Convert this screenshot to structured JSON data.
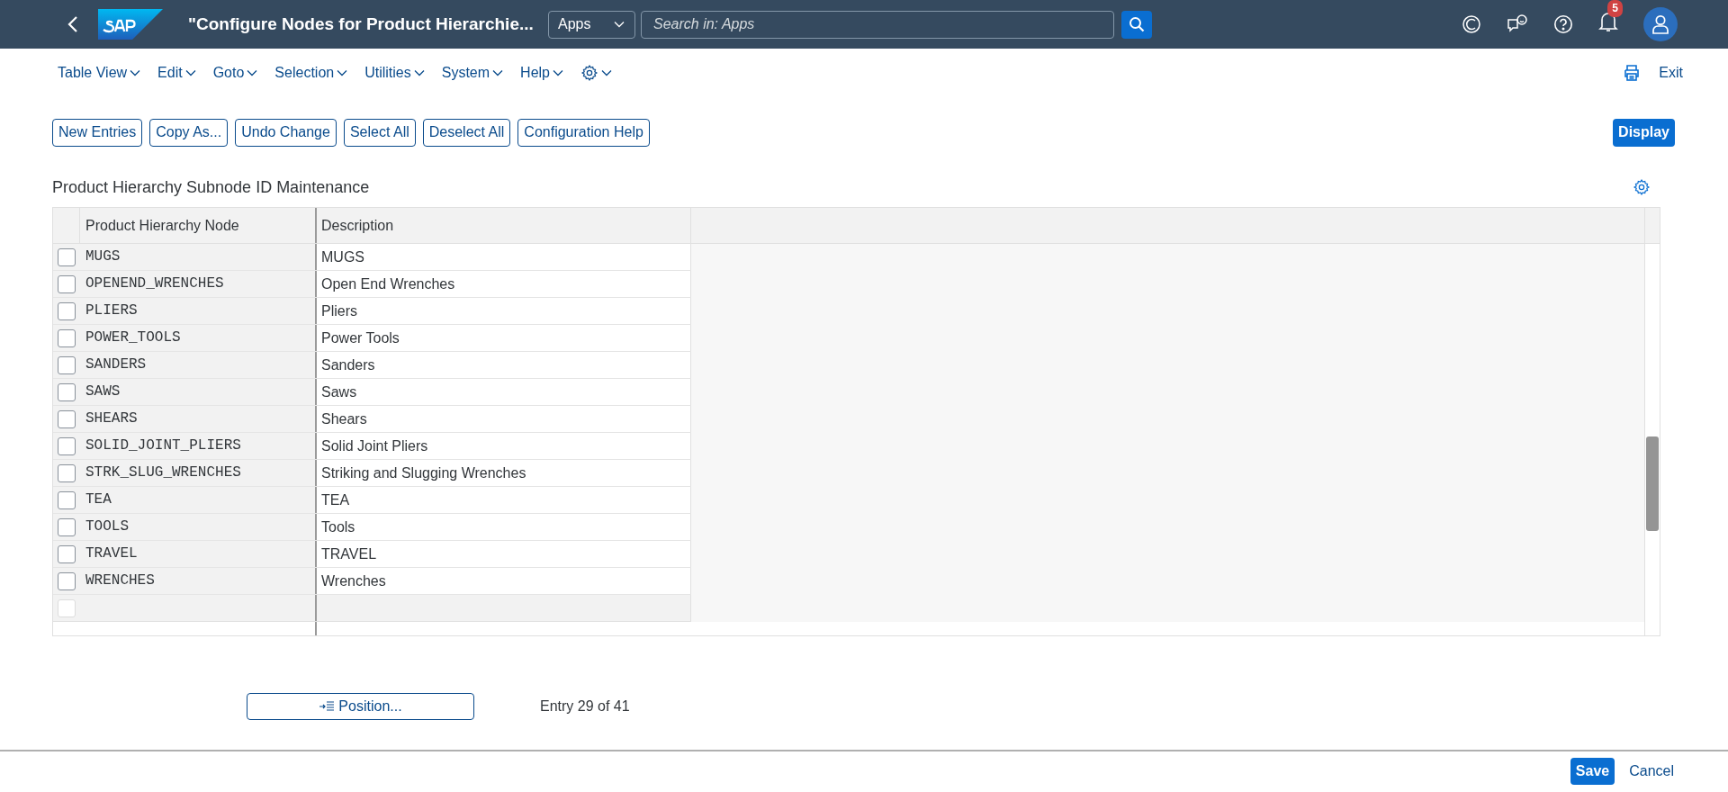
{
  "shell": {
    "title": "\"Configure Nodes for Product Hierarchie...",
    "scope": "Apps",
    "search": {
      "placeholder": "Search in: Apps"
    },
    "notification_count": "5"
  },
  "menu": {
    "items": [
      "Table View",
      "Edit",
      "Goto",
      "Selection",
      "Utilities",
      "System",
      "Help"
    ],
    "exit": "Exit"
  },
  "toolbar": {
    "buttons": [
      "New Entries",
      "Copy As...",
      "Undo Change",
      "Select All",
      "Deselect All",
      "Configuration Help"
    ],
    "display": "Display"
  },
  "table": {
    "title": "Product Hierarchy Subnode ID Maintenance",
    "columns": [
      "Product Hierarchy Node",
      "Description"
    ],
    "rows": [
      {
        "node": "MUGS",
        "description": "MUGS",
        "checked": false
      },
      {
        "node": "OPENEND_WRENCHES",
        "description": "Open End Wrenches",
        "checked": false
      },
      {
        "node": "PLIERS",
        "description": "Pliers",
        "checked": false
      },
      {
        "node": "POWER_TOOLS",
        "description": "Power Tools",
        "checked": false
      },
      {
        "node": "SANDERS",
        "description": "Sanders",
        "checked": false
      },
      {
        "node": "SAWS",
        "description": "Saws",
        "checked": false
      },
      {
        "node": "SHEARS",
        "description": "Shears",
        "checked": false
      },
      {
        "node": "SOLID_JOINT_PLIERS",
        "description": "Solid Joint Pliers",
        "checked": false
      },
      {
        "node": "STRK_SLUG_WRENCHES",
        "description": "Striking and Slugging Wrenches",
        "checked": false
      },
      {
        "node": "TEA",
        "description": "TEA",
        "checked": false
      },
      {
        "node": "TOOLS",
        "description": "Tools",
        "checked": false
      },
      {
        "node": "TRAVEL",
        "description": "TRAVEL",
        "checked": false
      },
      {
        "node": "WRENCHES",
        "description": "Wrenches",
        "checked": false
      }
    ],
    "blank_row": {
      "disabled": true
    }
  },
  "position_button": "Position...",
  "entry": "Entry 29 of 41",
  "footer": {
    "save": "Save",
    "cancel": "Cancel"
  }
}
